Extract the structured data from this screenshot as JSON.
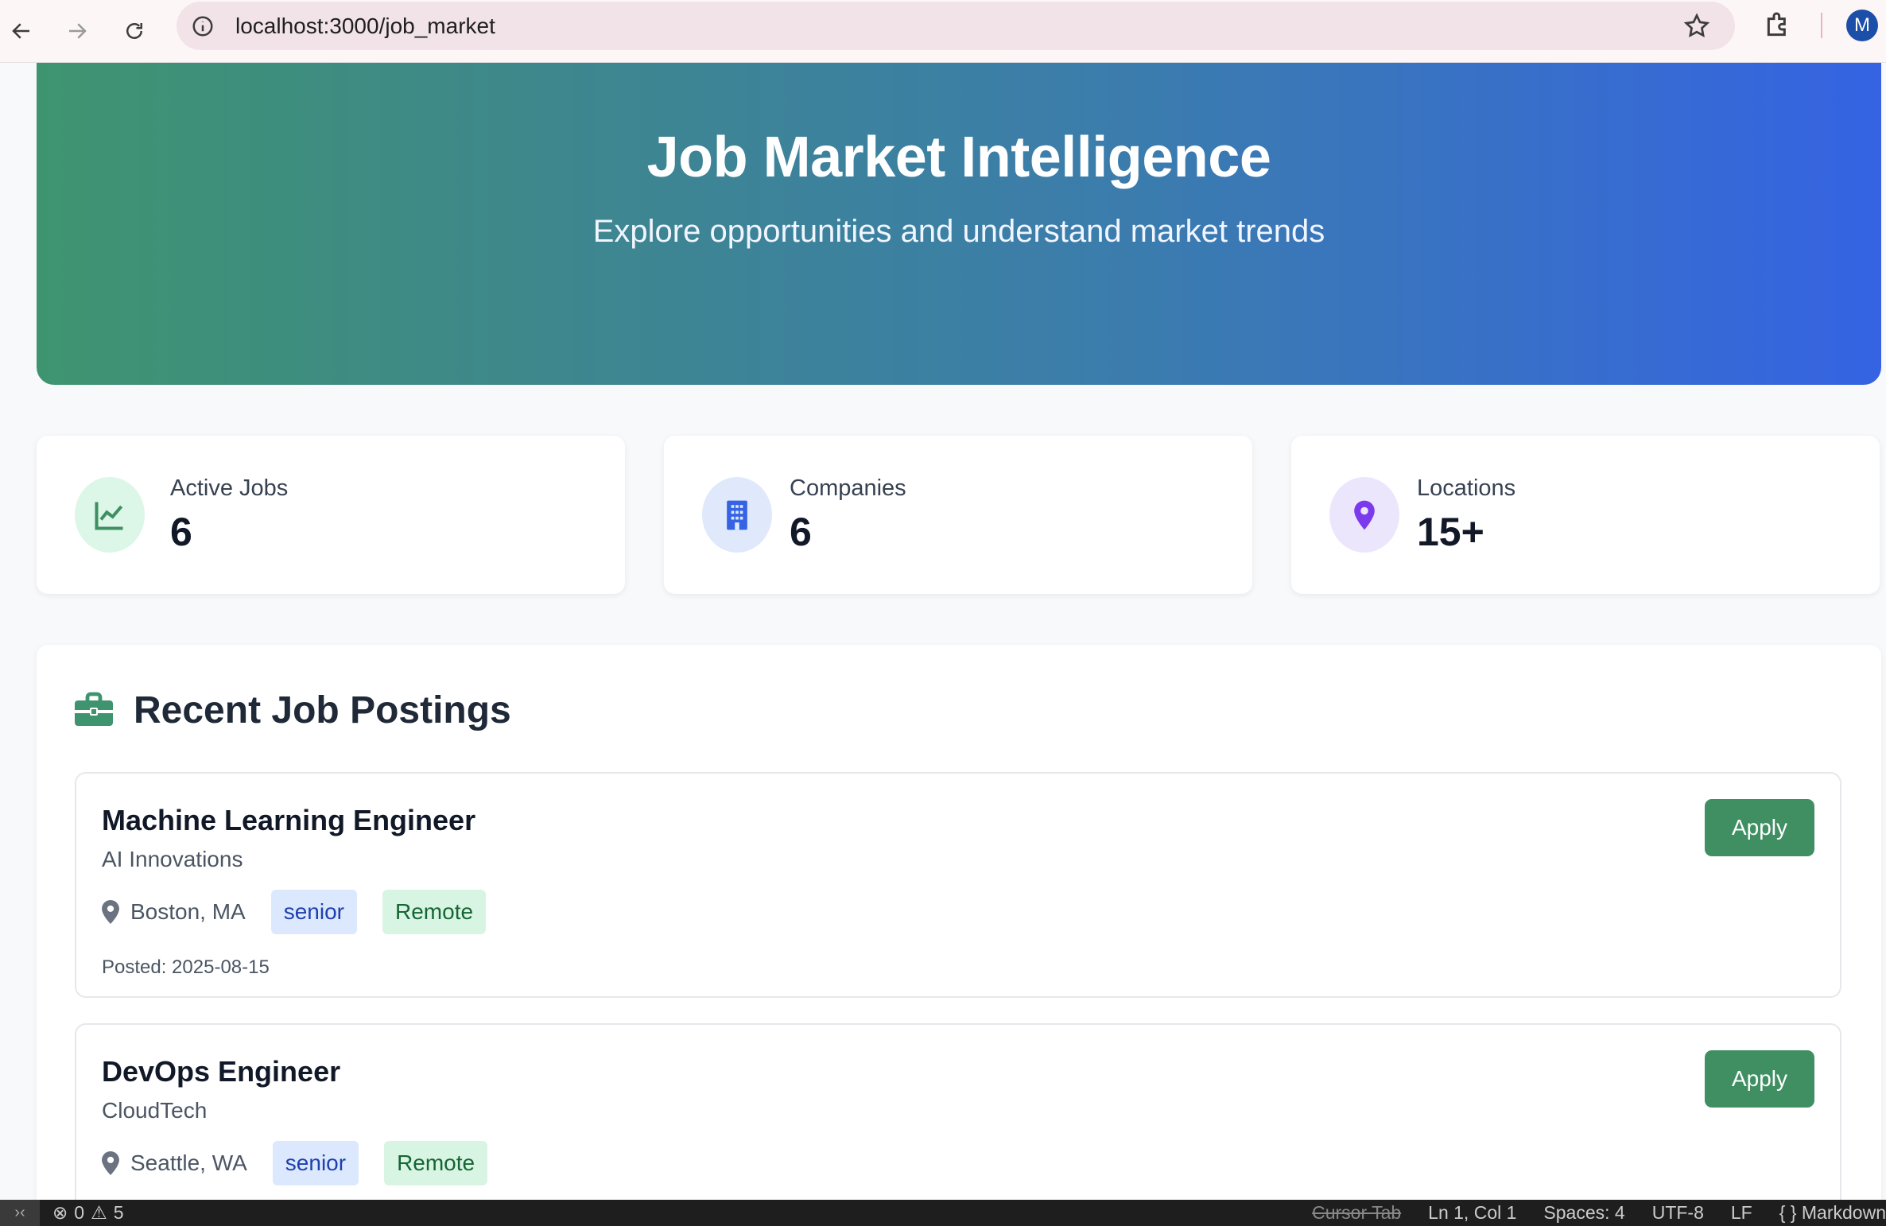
{
  "browser": {
    "url": "localhost:3000/job_market",
    "avatar_letter": "M"
  },
  "hero": {
    "title": "Job Market Intelligence",
    "subtitle": "Explore opportunities and understand market trends",
    "gradient_start": "#3f9470",
    "gradient_end": "#3563e3"
  },
  "stats": [
    {
      "label": "Active Jobs",
      "value": "6",
      "icon": "chart-line-icon",
      "icon_bg": "#dcf7e8",
      "icon_color": "#3f8f63"
    },
    {
      "label": "Companies",
      "value": "6",
      "icon": "building-icon",
      "icon_bg": "#dfe9fb",
      "icon_color": "#3563e3"
    },
    {
      "label": "Locations",
      "value": "15+",
      "icon": "location-pin-icon",
      "icon_bg": "#ece6fd",
      "icon_color": "#7c3aed"
    }
  ],
  "postings": {
    "heading": "Recent Job Postings",
    "icon": "briefcase-icon",
    "jobs": [
      {
        "title": "Machine Learning Engineer",
        "company": "AI Innovations",
        "location": "Boston, MA",
        "level": "senior",
        "remote": "Remote",
        "posted": "Posted: 2025-08-15",
        "apply_label": "Apply"
      },
      {
        "title": "DevOps Engineer",
        "company": "CloudTech",
        "location": "Seattle, WA",
        "level": "senior",
        "remote": "Remote",
        "apply_label": "Apply"
      }
    ]
  },
  "status_bar": {
    "errors": "0",
    "warnings": "5",
    "cursor_tab": "Cursor Tab",
    "position": "Ln 1, Col 1",
    "spaces": "Spaces: 4",
    "encoding": "UTF-8",
    "eol": "LF",
    "language": "Markdown"
  },
  "colors": {
    "accent_green": "#3f8f63",
    "level_tag_bg": "#dce8fd",
    "remote_tag_bg": "#d8f5e3"
  }
}
